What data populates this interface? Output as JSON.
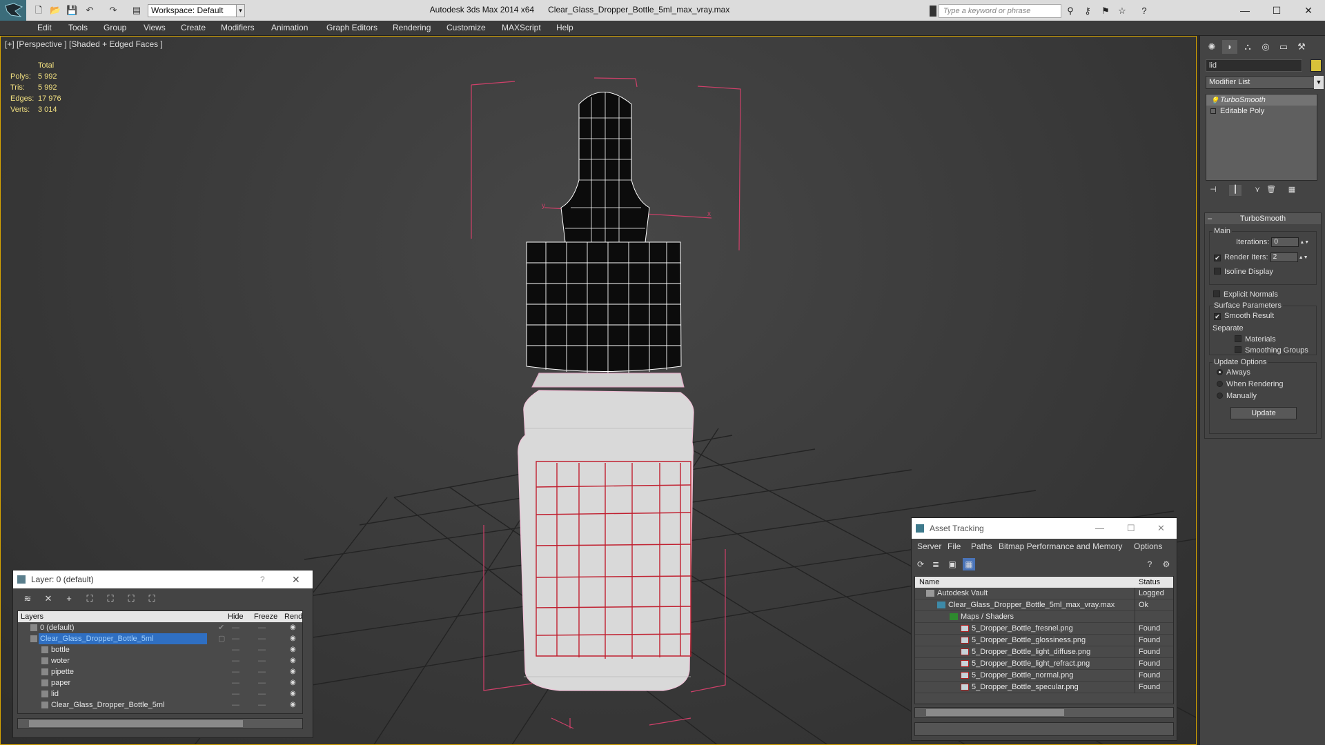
{
  "titlebar": {
    "workspace": "Workspace: Default",
    "window_title": "Autodesk 3ds Max 2014 x64      Clear_Glass_Dropper_Bottle_5ml_max_vray.max",
    "search_placeholder": "Type a keyword or phrase",
    "icons": [
      "new-file-icon",
      "open-file-icon",
      "save-icon",
      "undo-icon",
      "redo-icon",
      "project-folder-icon",
      "binoculars-icon",
      "key-icon",
      "star-icon",
      "help-icon"
    ],
    "window_buttons": [
      "—",
      "☐",
      "✕"
    ]
  },
  "menu": [
    "Edit",
    "Tools",
    "Group",
    "Views",
    "Create",
    "Modifiers",
    "Animation",
    "Graph Editors",
    "Rendering",
    "Customize",
    "MAXScript",
    "Help"
  ],
  "viewport": {
    "label": "[+] [Perspective ] [Shaded + Edged Faces ]",
    "stats": {
      "total_label": "Total",
      "rows": [
        {
          "k": "Polys:",
          "v": "5 992"
        },
        {
          "k": "Tris:",
          "v": "5 992"
        },
        {
          "k": "Edges:",
          "v": "17 976"
        },
        {
          "k": "Verts:",
          "v": "3 014"
        }
      ]
    },
    "gizmo_x": "x",
    "gizmo_y": "y"
  },
  "command_panel": {
    "object_name": "lid",
    "object_color": "#d8c23a",
    "modifier_list": "Modifier List",
    "stack": [
      "TurboSmooth",
      "Editable Poly"
    ],
    "rollout": {
      "title": "TurboSmooth",
      "main_label": "Main",
      "iterations_label": "Iterations:",
      "iterations_value": "0",
      "render_iters_label": "Render Iters:",
      "render_iters_value": "2",
      "isoline": "Isoline Display",
      "explicit_normals": "Explicit Normals",
      "surface_label": "Surface Parameters",
      "smooth_result": "Smooth Result",
      "separate_label": "Separate",
      "materials": "Materials",
      "smoothing_groups": "Smoothing Groups",
      "update_label": "Update Options",
      "always": "Always",
      "when_rendering": "When Rendering",
      "manually": "Manually",
      "update_button": "Update"
    }
  },
  "layer_dialog": {
    "title": "Layer: 0 (default)",
    "help": "?",
    "close": "✕",
    "columns": [
      "Layers",
      "Hide",
      "Freeze",
      "Rende"
    ],
    "rows": [
      {
        "name": "0 (default)",
        "indent": 0
      },
      {
        "name": "Clear_Glass_Dropper_Bottle_5ml",
        "indent": 0,
        "selected": true
      },
      {
        "name": "bottle",
        "indent": 1
      },
      {
        "name": "woter",
        "indent": 1
      },
      {
        "name": "pipette",
        "indent": 1
      },
      {
        "name": "paper",
        "indent": 1
      },
      {
        "name": "lid",
        "indent": 1
      },
      {
        "name": "Clear_Glass_Dropper_Bottle_5ml",
        "indent": 1
      }
    ]
  },
  "asset_tracking": {
    "title": "Asset Tracking",
    "menu": [
      "Server",
      "File",
      "Paths",
      "Bitmap Performance and Memory",
      "Options"
    ],
    "columns": [
      "Name",
      "Status"
    ],
    "rows": [
      {
        "name": "Autodesk Vault",
        "status": "Logged",
        "level": 0,
        "icon": "vault"
      },
      {
        "name": "Clear_Glass_Dropper_Bottle_5ml_max_vray.max",
        "status": "Ok",
        "level": 1,
        "icon": "max"
      },
      {
        "name": "Maps / Shaders",
        "status": "",
        "level": 2,
        "icon": "maps"
      },
      {
        "name": "5_Dropper_Bottle_fresnel.png",
        "status": "Found",
        "level": 3,
        "icon": "png"
      },
      {
        "name": "5_Dropper_Bottle_glossiness.png",
        "status": "Found",
        "level": 3,
        "icon": "png"
      },
      {
        "name": "5_Dropper_Bottle_light_diffuse.png",
        "status": "Found",
        "level": 3,
        "icon": "png"
      },
      {
        "name": "5_Dropper_Bottle_light_refract.png",
        "status": "Found",
        "level": 3,
        "icon": "png"
      },
      {
        "name": "5_Dropper_Bottle_normal.png",
        "status": "Found",
        "level": 3,
        "icon": "png"
      },
      {
        "name": "5_Dropper_Bottle_specular.png",
        "status": "Found",
        "level": 3,
        "icon": "png"
      }
    ]
  }
}
